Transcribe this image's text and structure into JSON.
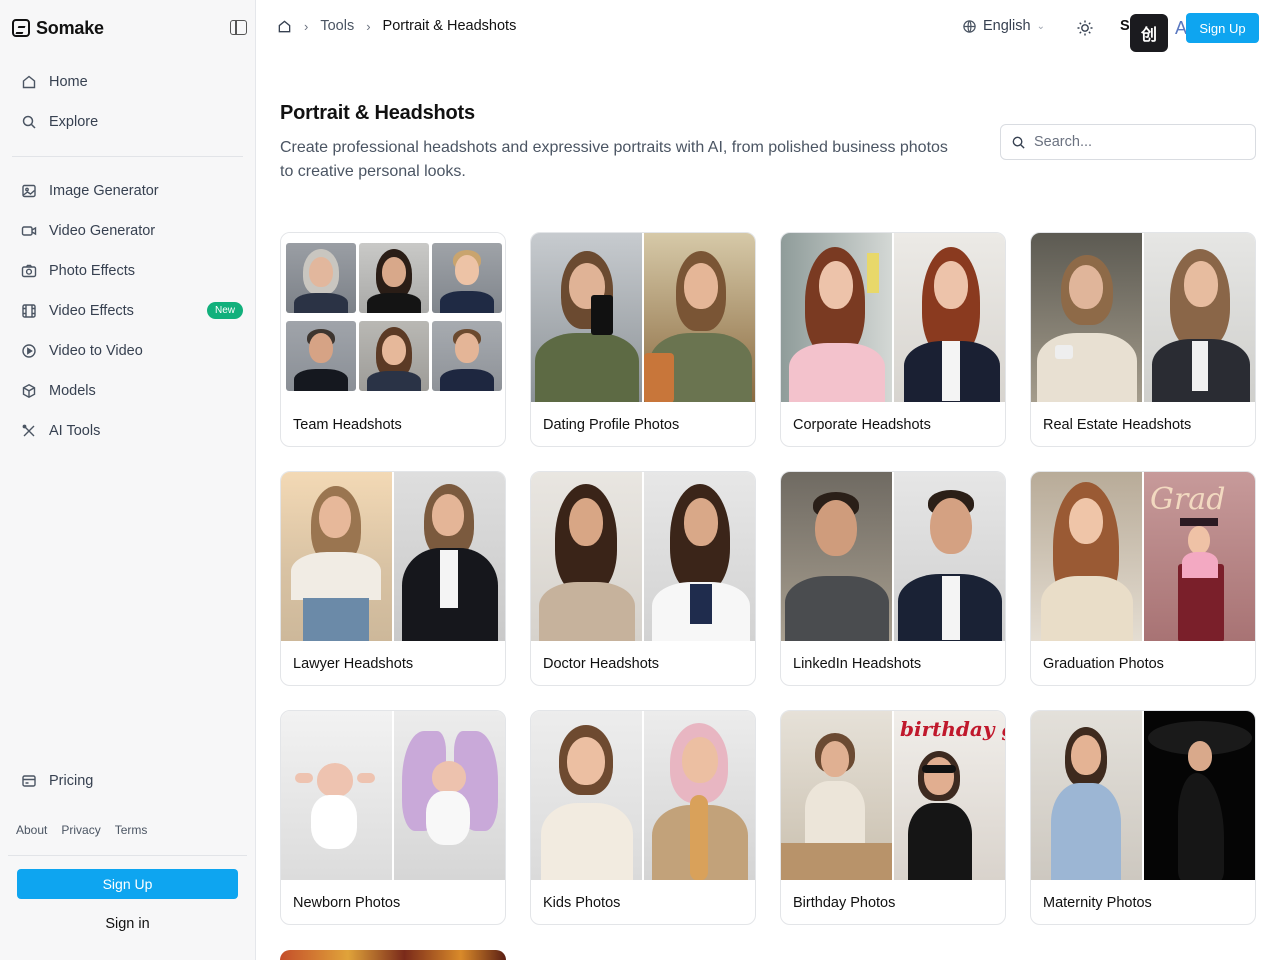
{
  "sidebar": {
    "brand": "Somake",
    "nav_primary": [
      {
        "label": "Home",
        "icon": "home-icon"
      },
      {
        "label": "Explore",
        "icon": "search-icon"
      }
    ],
    "nav_secondary": [
      {
        "label": "Image Generator",
        "icon": "image-icon"
      },
      {
        "label": "Video Generator",
        "icon": "video-icon"
      },
      {
        "label": "Photo Effects",
        "icon": "camera-icon"
      },
      {
        "label": "Video Effects",
        "icon": "film-icon",
        "badge": "New"
      },
      {
        "label": "Video to Video",
        "icon": "play-circle-icon"
      },
      {
        "label": "Models",
        "icon": "cube-icon"
      },
      {
        "label": "AI Tools",
        "icon": "tools-icon"
      }
    ],
    "pricing": {
      "label": "Pricing",
      "icon": "pricing-icon"
    },
    "footer_links": [
      "About",
      "Privacy",
      "Terms"
    ],
    "signup_label": "Sign Up",
    "signin_label": "Sign in"
  },
  "header": {
    "breadcrumb": {
      "link": "Tools",
      "current": "Portrait & Headshots"
    },
    "language": "English",
    "partial_text": "S",
    "app_logo_text": "创",
    "overlay_text": "AI",
    "signup_label": "Sign Up"
  },
  "page": {
    "title": "Portrait & Headshots",
    "description": "Create professional headshots and expressive portraits with AI, from polished business photos to creative personal looks.",
    "search_placeholder": "Search..."
  },
  "cards": [
    {
      "label": "Team Headshots"
    },
    {
      "label": "Dating Profile Photos"
    },
    {
      "label": "Corporate Headshots"
    },
    {
      "label": "Real Estate Headshots"
    },
    {
      "label": "Lawyer Headshots"
    },
    {
      "label": "Doctor Headshots"
    },
    {
      "label": "LinkedIn Headshots"
    },
    {
      "label": "Graduation Photos"
    },
    {
      "label": "Newborn Photos"
    },
    {
      "label": "Kids Photos"
    },
    {
      "label": "Birthday Photos"
    },
    {
      "label": "Maternity Photos"
    }
  ],
  "colors": {
    "accent": "#0ea5f0",
    "badge_green": "#12b07c",
    "sidebar_bg": "#f7f7f8"
  }
}
